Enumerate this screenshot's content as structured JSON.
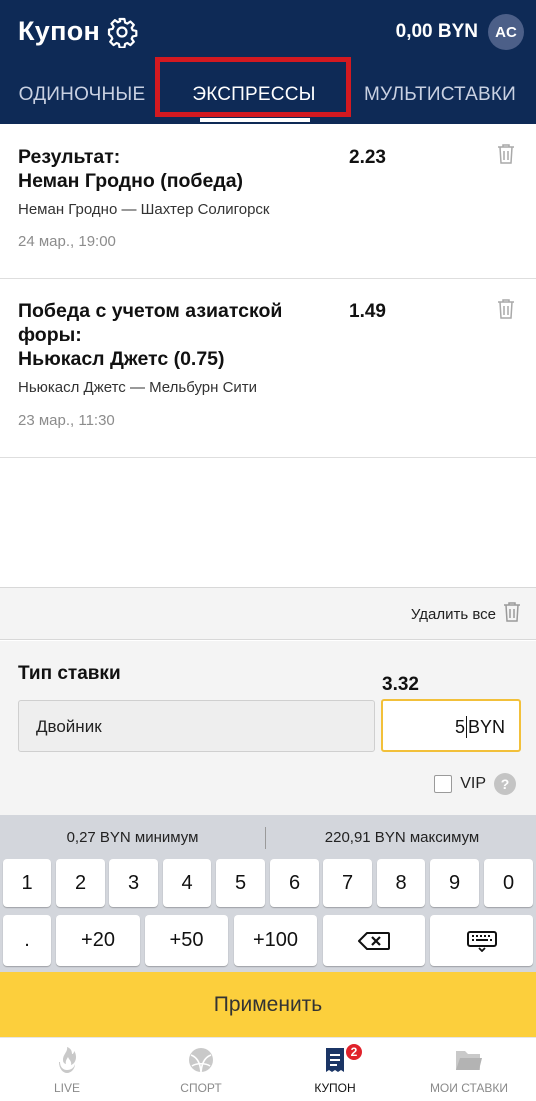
{
  "header": {
    "title": "Купон",
    "balance": "0,00 BYN",
    "avatar_initials": "AC"
  },
  "tabs": [
    {
      "label": "ОДИНОЧНЫЕ",
      "active": false
    },
    {
      "label": "ЭКСПРЕССЫ",
      "active": true
    },
    {
      "label": "МУЛЬТИСТАВКИ",
      "active": false
    }
  ],
  "bets": [
    {
      "market_line1": "Результат:",
      "market_line2": "Неман Гродно (победа)",
      "odds": "2.23",
      "match": "Неман Гродно — Шахтер Солигорск",
      "date": "24 мар., 19:00"
    },
    {
      "market_line1": "Победа с учетом азиатской",
      "market_line2": "форы:",
      "market_line3": "Ньюкасл Джетс (0.75)",
      "odds": "1.49",
      "match": "Ньюкасл Джетс — Мельбурн Сити",
      "date": "23 мар., 11:30"
    }
  ],
  "delete_all_label": "Удалить все",
  "bet_type": {
    "label": "Тип ставки",
    "total_odds": "3.32",
    "selected": "Двойник",
    "stake_value": "5",
    "stake_currency": "BYN",
    "vip_label": "VIP",
    "vip_help": "?"
  },
  "keyboard": {
    "min_label": "0,27 BYN минимум",
    "max_label": "220,91 BYN максимум",
    "digits": [
      "1",
      "2",
      "3",
      "4",
      "5",
      "6",
      "7",
      "8",
      "9",
      "0"
    ],
    "row2": [
      ".",
      "+20",
      "+50",
      "+100"
    ]
  },
  "apply_label": "Применить",
  "nav": [
    {
      "label": "LIVE",
      "icon": "fire-icon"
    },
    {
      "label": "СПОРТ",
      "icon": "ball-icon"
    },
    {
      "label": "КУПОН",
      "icon": "coupon-icon",
      "badge": "2",
      "active": true
    },
    {
      "label": "МОИ СТАВКИ",
      "icon": "folder-icon"
    }
  ],
  "colors": {
    "header_bg": "#0e2a56",
    "highlight": "#d31920",
    "apply_bg": "#fccf3c",
    "stake_border": "#f2c03a",
    "badge": "#e0222b"
  }
}
